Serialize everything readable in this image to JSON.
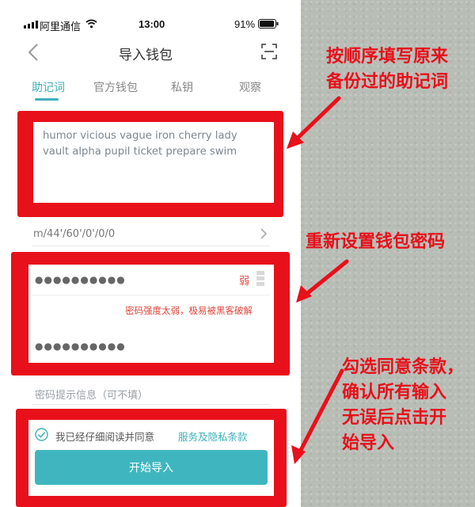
{
  "status_bar": {
    "carrier": "阿里通信",
    "time": "13:00",
    "battery": "91%"
  },
  "header": {
    "title": "导入钱包",
    "back_icon": "chevron-left-icon",
    "scan_icon": "scan-icon"
  },
  "tabs": [
    {
      "label": "助记词",
      "active": true
    },
    {
      "label": "官方钱包",
      "active": false
    },
    {
      "label": "私钥",
      "active": false
    },
    {
      "label": "观察",
      "active": false
    }
  ],
  "mnemonic": {
    "line1": "humor vicious vague iron cherry lady",
    "line2": "vault alpha pupil ticket prepare swim"
  },
  "path": {
    "value": "m/44'/60'/0'/0/0"
  },
  "password": {
    "value_masked": "●●●●●●●●●●",
    "strength_label": "弱",
    "warning": "密码强度太弱，极易被黑客破解",
    "confirm_masked": "●●●●●●●●●●"
  },
  "password_hint": {
    "placeholder": "密码提示信息（可不填）"
  },
  "agreement": {
    "prefix": "我已经仔细阅读并同意",
    "link": "服务及隐私条款",
    "checked": true
  },
  "start_button": {
    "label": "开始导入"
  },
  "annotations": {
    "note1_line1": "按顺序填写原来",
    "note1_line2": "备份过的助记词",
    "note2": "重新设置钱包密码",
    "note3_line1": "勾选同意条款，",
    "note3_line2": "确认所有输入",
    "note3_line3": "无误后点击开",
    "note3_line4": "始导入"
  },
  "colors": {
    "accent": "#3db1ba",
    "marker_red": "#e8101a",
    "warning_red": "#e0443a"
  }
}
